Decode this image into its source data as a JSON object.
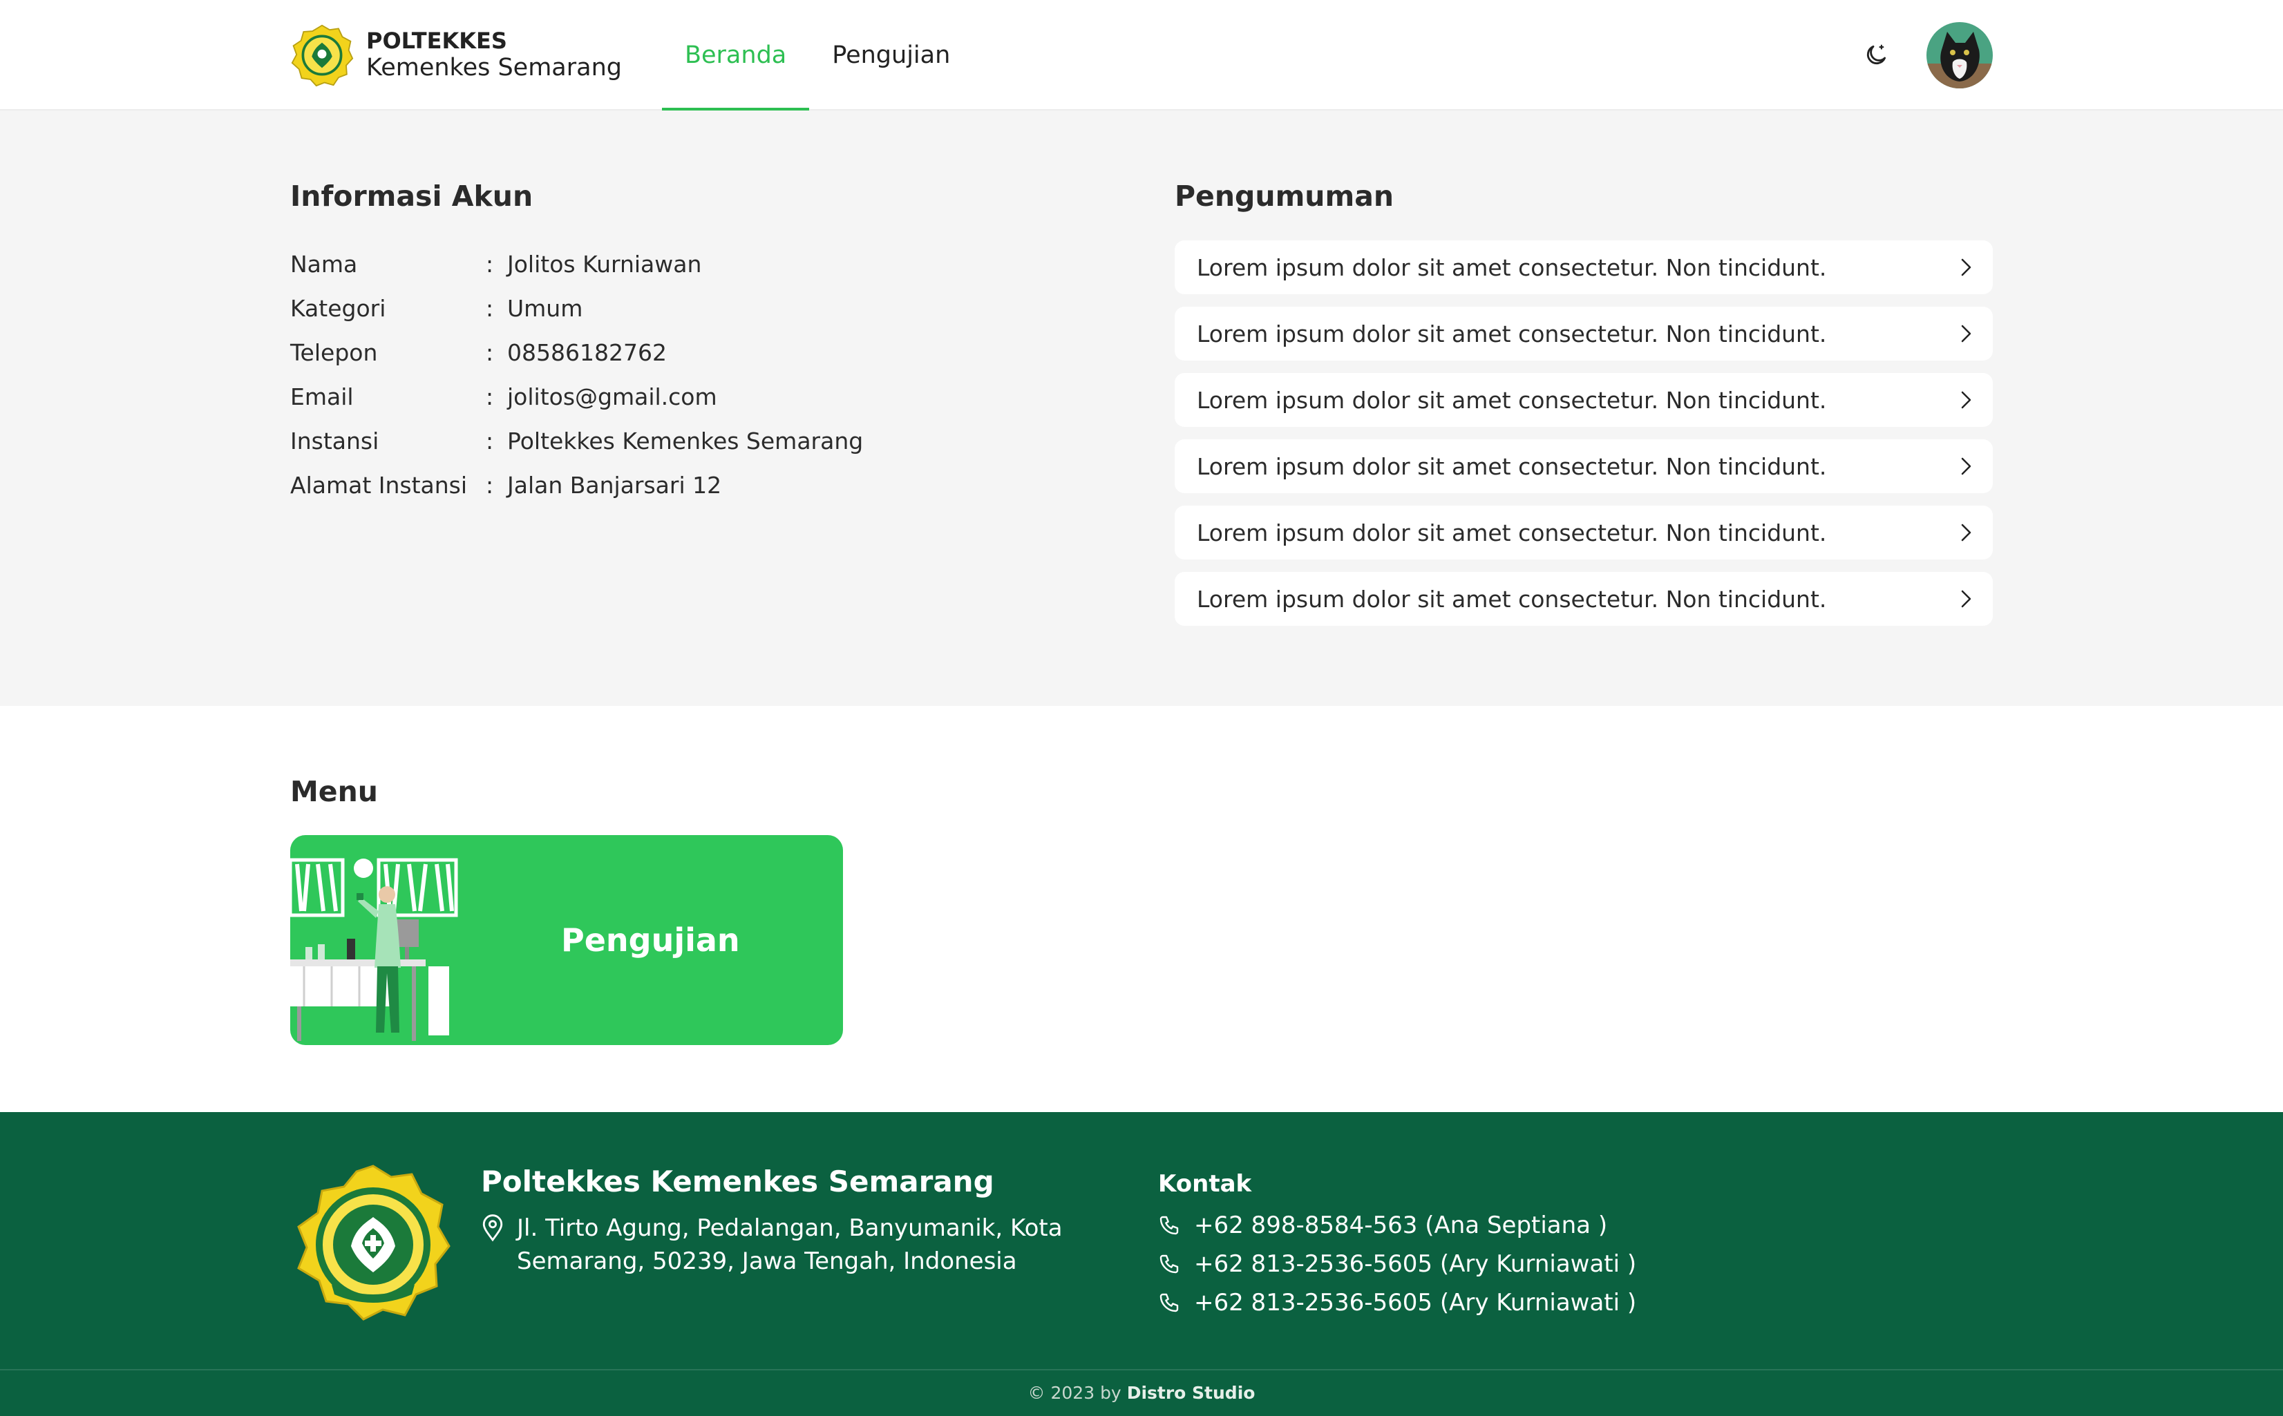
{
  "header": {
    "brand_line1": "POLTEKKES",
    "brand_line2": "Kemenkes Semarang",
    "nav": [
      {
        "label": "Beranda",
        "active": true
      },
      {
        "label": "Pengujian",
        "active": false
      }
    ],
    "theme_icon": "moon-icon",
    "avatar": "avatar"
  },
  "account": {
    "title": "Informasi Akun",
    "separator": ":",
    "rows": [
      {
        "label": "Nama",
        "value": "Jolitos Kurniawan"
      },
      {
        "label": "Kategori",
        "value": "Umum"
      },
      {
        "label": "Telepon",
        "value": "08586182762"
      },
      {
        "label": "Email",
        "value": "jolitos@gmail.com"
      },
      {
        "label": "Instansi",
        "value": "Poltekkes Kemenkes Semarang"
      },
      {
        "label": "Alamat Instansi",
        "value": "Jalan Banjarsari 12"
      }
    ]
  },
  "announcements": {
    "title": "Pengumuman",
    "items": [
      "Lorem ipsum dolor sit amet consectetur. Non tincidunt.",
      "Lorem ipsum dolor sit amet consectetur. Non tincidunt.",
      "Lorem ipsum dolor sit amet consectetur. Non tincidunt.",
      "Lorem ipsum dolor sit amet consectetur. Non tincidunt.",
      "Lorem ipsum dolor sit amet consectetur. Non tincidunt.",
      "Lorem ipsum dolor sit amet consectetur. Non tincidunt."
    ]
  },
  "menu": {
    "title": "Menu",
    "card_label": "Pengujian"
  },
  "footer": {
    "org": "Poltekkes Kemenkes Semarang",
    "address": "Jl. Tirto Agung, Pedalangan, Banyumanik, Kota Semarang, 50239, Jawa Tengah, Indonesia",
    "contact_title": "Kontak",
    "contacts": [
      "+62 898-8584-563 (Ana Septiana )",
      "+62 813-2536-5605 (Ary Kurniawati )",
      "+62 813-2536-5605 (Ary Kurniawati )"
    ],
    "copyright_prefix": "© 2023 by",
    "copyright_brand": "Distro Studio"
  },
  "colors": {
    "accent": "#2dbf52",
    "card": "#2fc75a",
    "footer": "#0b6140",
    "section_bg": "#f5f5f5"
  }
}
